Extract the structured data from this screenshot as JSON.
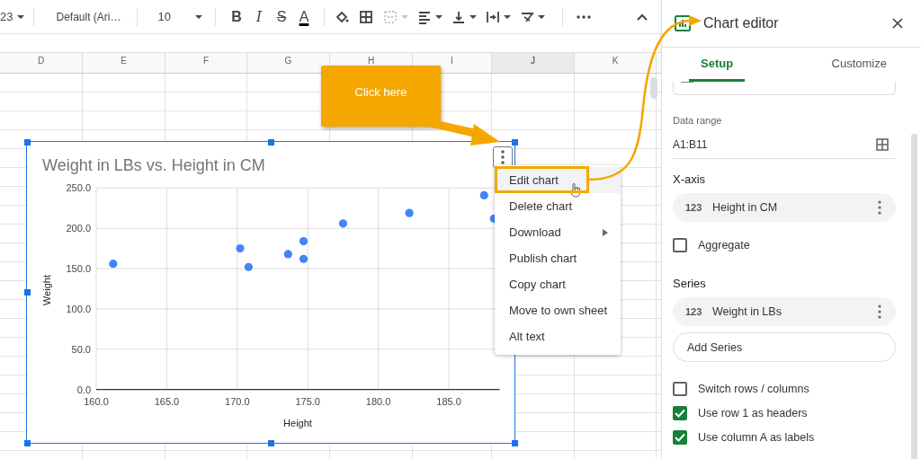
{
  "toolbar": {
    "zoom": "23",
    "font": "Default (Ari…",
    "font_size": "10",
    "format_buttons": [
      {
        "kind": "bold",
        "label": "B"
      },
      {
        "kind": "italic",
        "label": "I"
      },
      {
        "kind": "strike",
        "label": "S"
      },
      {
        "kind": "color",
        "label": "A"
      }
    ],
    "tools": [
      {
        "kind": "fill",
        "disabled": false
      },
      {
        "kind": "borders",
        "disabled": false
      },
      {
        "kind": "merge",
        "disabled": true
      },
      {
        "kind": "align",
        "disabled": false
      },
      {
        "kind": "valign",
        "disabled": false
      },
      {
        "kind": "wrap",
        "disabled": false
      },
      {
        "kind": "rotate",
        "disabled": false
      }
    ]
  },
  "columns": [
    {
      "label": "D",
      "selected": false
    },
    {
      "label": "E",
      "selected": false
    },
    {
      "label": "F",
      "selected": false
    },
    {
      "label": "G",
      "selected": false
    },
    {
      "label": "H",
      "selected": false
    },
    {
      "label": "I",
      "selected": false
    },
    {
      "label": "J",
      "selected": true
    },
    {
      "label": "K",
      "selected": false
    }
  ],
  "callout": {
    "text": "Click here"
  },
  "chart": {
    "chart_data": {
      "type": "scatter",
      "title": "Weight in LBs vs. Height in CM",
      "xlabel": "Height",
      "ylabel": "Weight",
      "x": [
        161.2,
        170.2,
        170.8,
        173.6,
        174.7,
        174.7,
        177.5,
        182.2,
        187.5,
        188.2
      ],
      "grid": true,
      "series": [
        {
          "color": "#4285f4",
          "values": [
            156,
            175,
            152,
            168,
            184,
            162,
            206,
            219,
            241,
            212
          ]
        }
      ],
      "xlim": [
        160,
        188.6
      ],
      "ylim": [
        0,
        250
      ],
      "xticks": [
        {
          "value": 160,
          "label": "160.0"
        },
        {
          "value": 165,
          "label": "165.0"
        },
        {
          "value": 170,
          "label": "170.0"
        },
        {
          "value": 175,
          "label": "175.0"
        },
        {
          "value": 180,
          "label": "180.0"
        },
        {
          "value": 185,
          "label": "185.0"
        }
      ],
      "yticks": [
        {
          "value": 0,
          "label": "0.0"
        },
        {
          "value": 50,
          "label": "50.0"
        },
        {
          "value": 100,
          "label": "100.0"
        },
        {
          "value": 150,
          "label": "150.0"
        },
        {
          "value": 200,
          "label": "200.0"
        },
        {
          "value": 250,
          "label": "250.0"
        }
      ]
    }
  },
  "menu": {
    "items": [
      {
        "label": "Edit chart",
        "selected": true,
        "has_submenu": false
      },
      {
        "label": "Delete chart",
        "selected": false,
        "has_submenu": false
      },
      {
        "label": "Download",
        "selected": false,
        "has_submenu": true
      },
      {
        "label": "Publish chart",
        "selected": false,
        "has_submenu": false
      },
      {
        "label": "Copy chart",
        "selected": false,
        "has_submenu": false
      },
      {
        "label": "Move to own sheet",
        "selected": false,
        "has_submenu": false
      },
      {
        "label": "Alt text",
        "selected": false,
        "has_submenu": false
      }
    ]
  },
  "panel": {
    "title": "Chart editor",
    "tabs": [
      {
        "label": "Setup",
        "selected": true
      },
      {
        "label": "Customize",
        "selected": false
      }
    ],
    "data_range": {
      "label": "Data range",
      "value": "A1:B11"
    },
    "x_axis": {
      "heading": "X-axis",
      "chips": [
        {
          "type_label": "123",
          "label": "Height in CM"
        }
      ]
    },
    "aggregate": {
      "label": "Aggregate",
      "checked": false
    },
    "series": {
      "heading": "Series",
      "chips": [
        {
          "type_label": "123",
          "label": "Weight in LBs"
        }
      ],
      "add_button": "Add Series"
    },
    "options": [
      {
        "label": "Switch rows / columns",
        "checked": false
      },
      {
        "label": "Use row 1 as headers",
        "checked": true
      },
      {
        "label": "Use column A as labels",
        "checked": true
      }
    ]
  }
}
